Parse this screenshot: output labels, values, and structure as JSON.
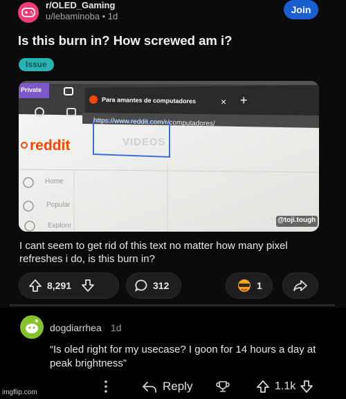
{
  "post": {
    "subreddit": "r/OLED_Gaming",
    "meta": "u/lebaminoba • 1d",
    "join_label": "Join",
    "title": "Is this burn in? How screwed am i?",
    "flair": "Issue",
    "body": "I cant seem to get rid of this text no matter how many pixel refreshes i do, is this burn in?",
    "upvotes": "8,291",
    "comments": "312",
    "award_count": "1"
  },
  "photo": {
    "private_label": "Private",
    "tab_title": "Para amantes de computadores",
    "tab_close": "×",
    "new_tab": "+",
    "url": "https://www.reddit.com/r/computadores/",
    "burned_text": "VIDEOS",
    "reddit_logo": "reddit",
    "nav_home": "Home",
    "nav_popular": "Popular",
    "nav_explore": "Explore",
    "credit": "@toji.tough"
  },
  "comment": {
    "username": "dogdiarrhea",
    "time": "1d",
    "text": "“Is oled right for my usecase? I goon for 14 hours a day at peak brightness”",
    "reply_label": "Reply",
    "votes": "1.1k"
  },
  "watermark": "imgflip.com",
  "colors": {
    "join": "#1a5fd1",
    "flair": "#2ab3b3",
    "sub_avatar": "#f33b7a",
    "reddit_orange": "#ff4500",
    "annotation": "#3b6fd8"
  },
  "icons": [
    "gamepad-icon",
    "upvote-icon",
    "downvote-icon",
    "comment-icon",
    "award-icon",
    "share-icon",
    "more-icon",
    "reply-icon",
    "trophy-icon"
  ]
}
